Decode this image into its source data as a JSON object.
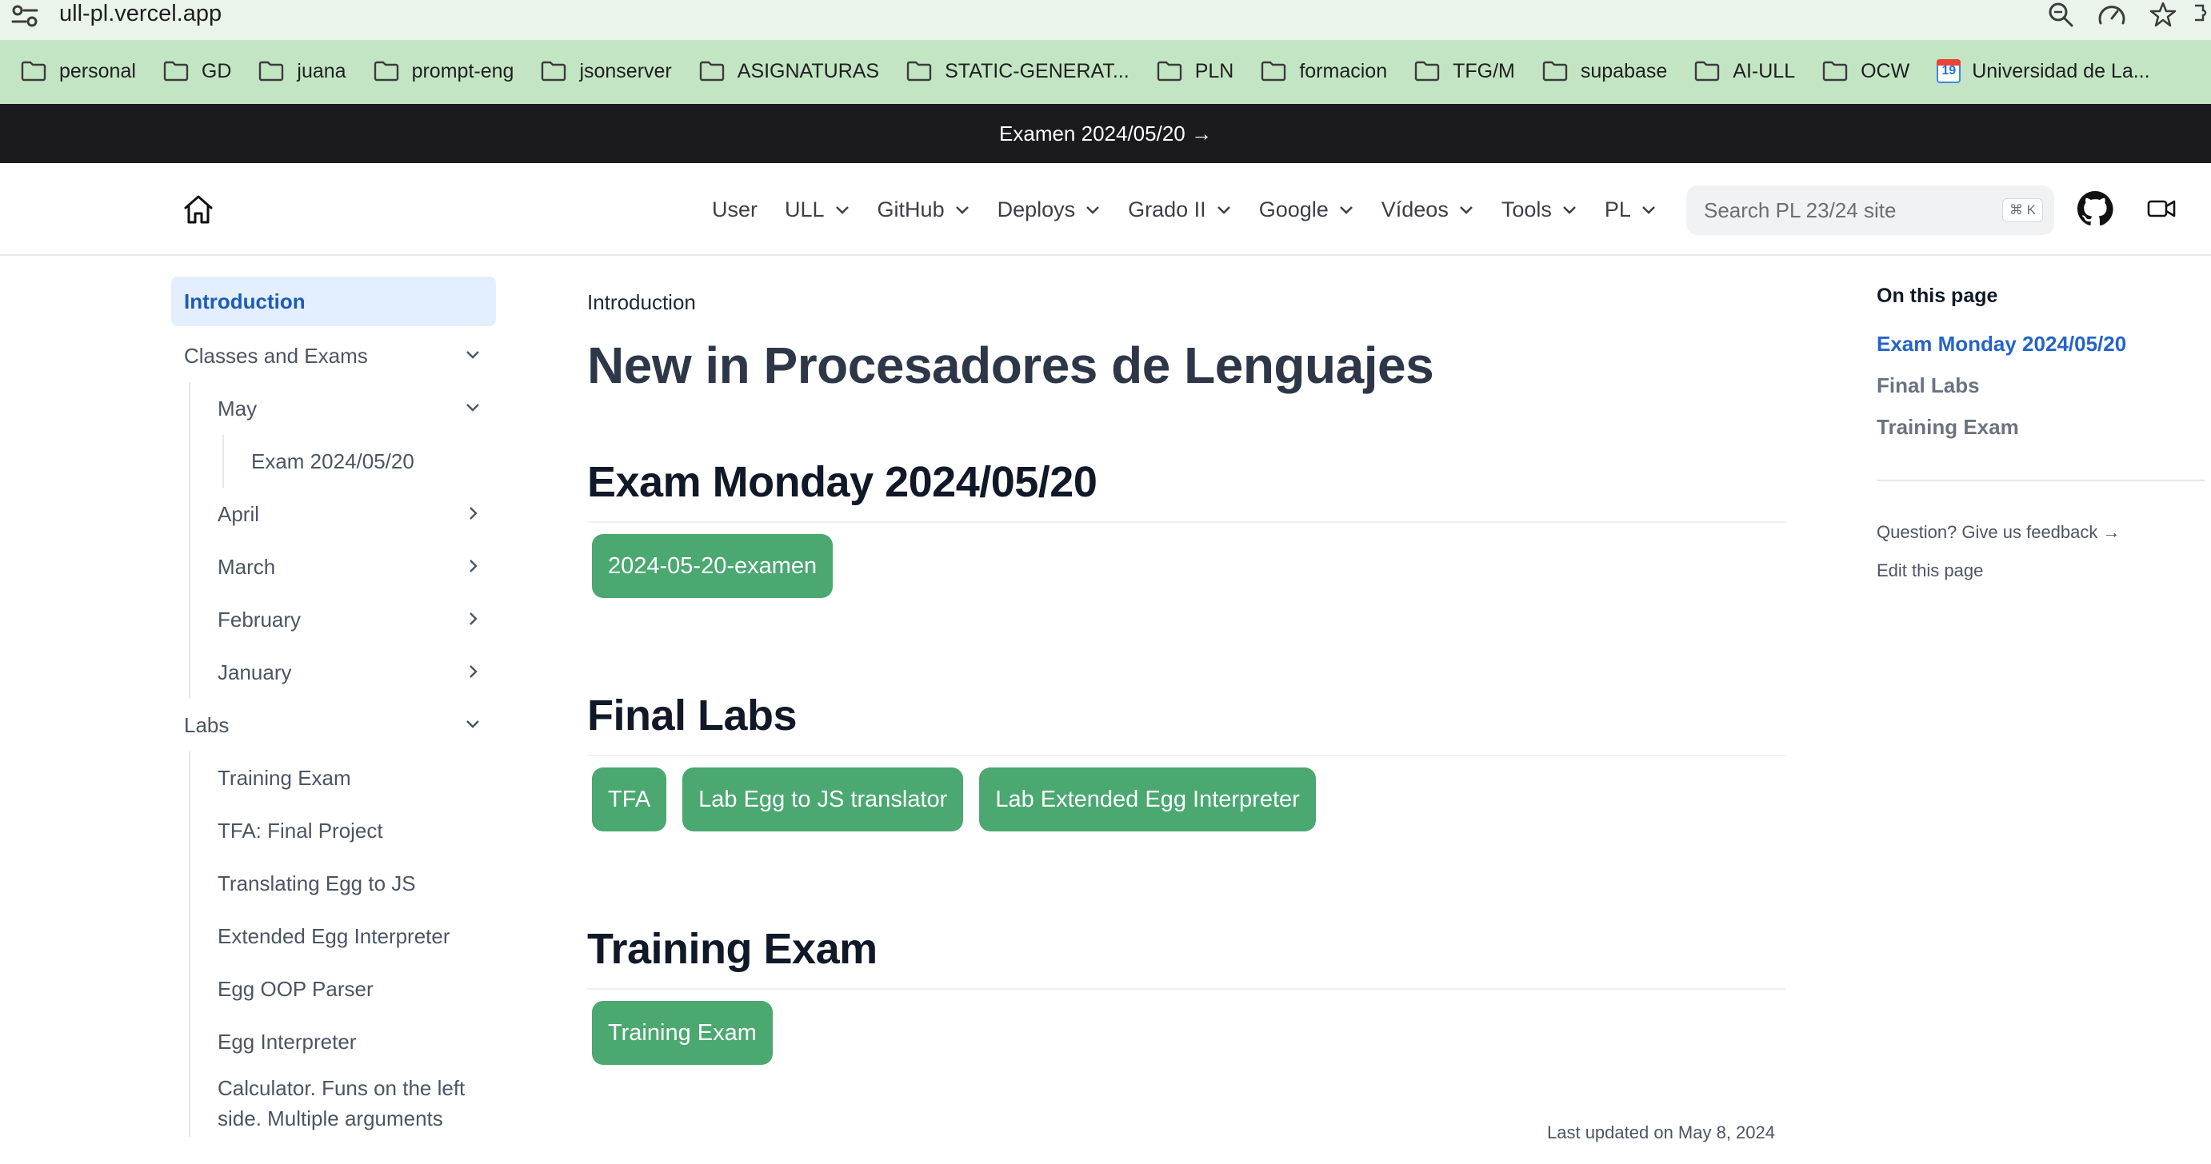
{
  "browser": {
    "url": "ull-pl.vercel.app",
    "bookmarks": [
      {
        "label": "personal",
        "icon": "folder-icon"
      },
      {
        "label": "GD",
        "icon": "folder-icon"
      },
      {
        "label": "juana",
        "icon": "folder-icon"
      },
      {
        "label": "prompt-eng",
        "icon": "folder-icon"
      },
      {
        "label": "jsonserver",
        "icon": "folder-icon"
      },
      {
        "label": "ASIGNATURAS",
        "icon": "folder-icon"
      },
      {
        "label": "STATIC-GENERAT...",
        "icon": "folder-icon"
      },
      {
        "label": "PLN",
        "icon": "folder-icon"
      },
      {
        "label": "formacion",
        "icon": "folder-icon"
      },
      {
        "label": "TFG/M",
        "icon": "folder-icon"
      },
      {
        "label": "supabase",
        "icon": "folder-icon"
      },
      {
        "label": "AI-ULL",
        "icon": "folder-icon"
      },
      {
        "label": "OCW",
        "icon": "folder-icon"
      },
      {
        "label": "Universidad de La...",
        "icon": "calendar-icon",
        "badge": "19"
      }
    ]
  },
  "banner": {
    "text": "Examen 2024/05/20 →"
  },
  "navbar": {
    "items": [
      {
        "label": "User",
        "dropdown": false
      },
      {
        "label": "ULL",
        "dropdown": true
      },
      {
        "label": "GitHub",
        "dropdown": true
      },
      {
        "label": "Deploys",
        "dropdown": true
      },
      {
        "label": "Grado II",
        "dropdown": true
      },
      {
        "label": "Google",
        "dropdown": true
      },
      {
        "label": "Vídeos",
        "dropdown": true
      },
      {
        "label": "Tools",
        "dropdown": true
      },
      {
        "label": "PL",
        "dropdown": true
      }
    ],
    "search": {
      "placeholder": "Search PL 23/24 site",
      "shortcut": "⌘ K"
    }
  },
  "sidebar": {
    "introduction": "Introduction",
    "classes_and_exams": "Classes and Exams",
    "may": "May",
    "exam_item": "Exam 2024/05/20",
    "april": "April",
    "march": "March",
    "february": "February",
    "january": "January",
    "labs": "Labs",
    "labs_items": [
      "Training Exam",
      "TFA: Final Project",
      "Translating Egg to JS",
      "Extended Egg Interpreter",
      "Egg OOP Parser",
      "Egg Interpreter",
      "Calculator. Funs on the left side. Multiple arguments"
    ]
  },
  "main": {
    "breadcrumb": "Introduction",
    "title": "New in Procesadores de Lenguajes",
    "sections": [
      {
        "heading": "Exam Monday 2024/05/20",
        "buttons": [
          "2024-05-20-examen"
        ]
      },
      {
        "heading": "Final Labs",
        "buttons": [
          "TFA",
          "Lab Egg to JS translator",
          "Lab Extended Egg Interpreter"
        ]
      },
      {
        "heading": "Training Exam",
        "buttons": [
          "Training Exam"
        ]
      }
    ],
    "last_updated": "Last updated on May 8, 2024",
    "button_color": "#4aa870"
  },
  "toc": {
    "title": "On this page",
    "links": [
      "Exam Monday 2024/05/20",
      "Final Labs",
      "Training Exam"
    ],
    "feedback": "Question? Give us feedback →",
    "edit": "Edit this page",
    "accent": "#2563c9"
  }
}
